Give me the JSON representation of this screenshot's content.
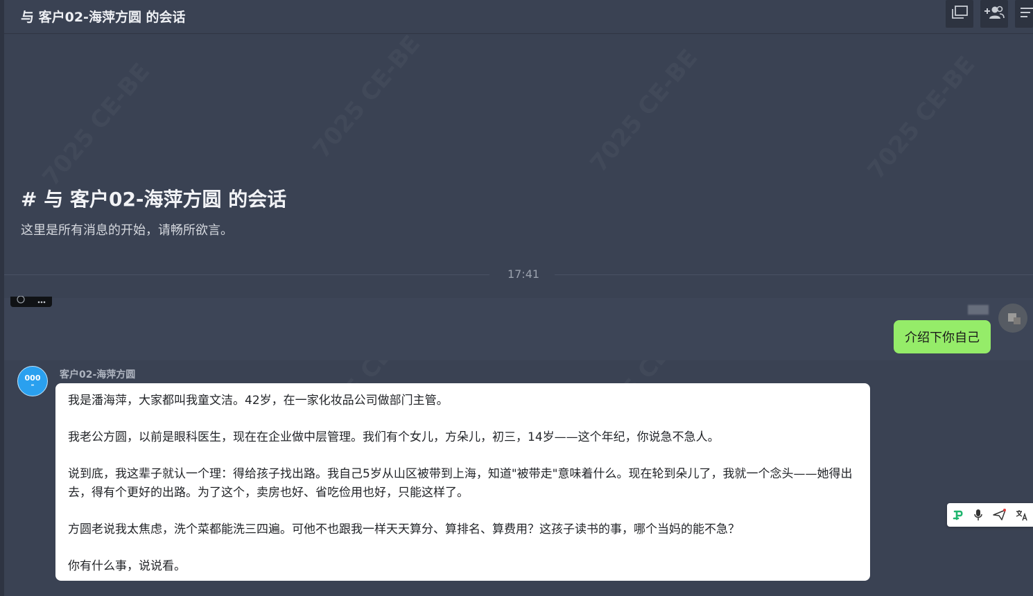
{
  "header": {
    "title": "与 客户02-海萍方圆 的会话",
    "icons": [
      "window-icon",
      "add-member-icon",
      "menu-icon"
    ]
  },
  "intro": {
    "title": "# 与 客户02-海萍方圆 的会话",
    "subtitle": "这里是所有消息的开始，请畅所欲言。"
  },
  "timestamp": "17:41",
  "messages": [
    {
      "role": "user",
      "text": "介绍下你自己",
      "bubble_color": "#95ec69"
    },
    {
      "role": "bot",
      "sender": "客户02-海萍方圆",
      "avatar_text": "000",
      "avatar_color": "#2aa0ef",
      "paragraphs": [
        "我是潘海萍，大家都叫我童文洁。42岁，在一家化妆品公司做部门主管。",
        "我老公方圆，以前是眼科医生，现在在企业做中层管理。我们有个女儿，方朵儿，初三，14岁——这个年纪，你说急不急人。",
        "说到底，我这辈子就认一个理：得给孩子找出路。我自己5岁从山区被带到上海，知道\"被带走\"意味着什么。现在轮到朵儿了，我就一个念头——她得出去，得有个更好的出路。为了这个，卖房也好、省吃俭用也好，只能这样了。",
        "方圆老说我太焦虑，洗个菜都能洗三四遍。可他不也跟我一样天天算分、算排名、算费用？这孩子读书的事，哪个当妈的能不急？",
        "你有什么事，说说看。"
      ]
    }
  ],
  "float_toolbar": {
    "icons": [
      "brand-logo-icon",
      "microphone-icon",
      "send-icon",
      "translate-icon"
    ],
    "accent": "#1fb56e"
  },
  "colors": {
    "background": "#3a4253",
    "header_button": "#2d3340",
    "bot_bubble": "#ffffff"
  }
}
